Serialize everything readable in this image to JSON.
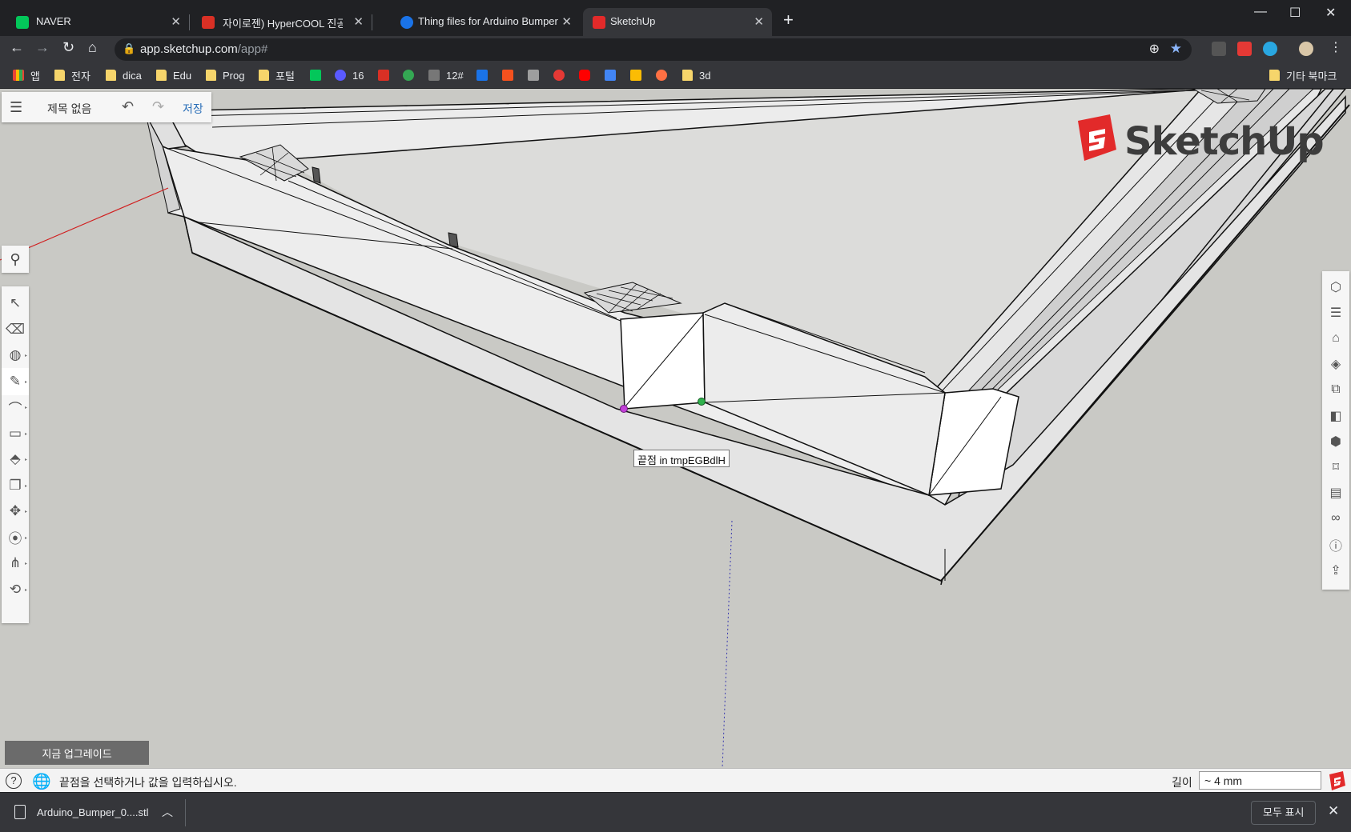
{
  "browser": {
    "tabs": [
      {
        "title": "NAVER",
        "favicon_color": "#03c75a",
        "favicon_letter": "N"
      },
      {
        "title": "자이로젠) HyperCOOL 진공 센서",
        "favicon_color": "#d93025",
        "favicon_letter": "M"
      },
      {
        "title": "Thing files for Arduino Bumper",
        "favicon_color": "#1a73e8",
        "favicon_letter": "T"
      },
      {
        "title": "SketchUp",
        "favicon_color": "#e22a2a",
        "favicon_letter": "S"
      }
    ],
    "new_tab_label": "+",
    "url_host": "app.sketchup.com",
    "url_path": "/app#",
    "bookmarks": [
      {
        "label": "앱",
        "type": "apps"
      },
      {
        "label": "전자",
        "type": "folder"
      },
      {
        "label": "dica",
        "type": "folder"
      },
      {
        "label": "Edu",
        "type": "folder"
      },
      {
        "label": "Prog",
        "type": "folder"
      },
      {
        "label": "포털",
        "type": "folder"
      },
      {
        "label": "",
        "type": "naver",
        "color": "#03c75a"
      },
      {
        "label": "16",
        "type": "site",
        "color": "#5a5aff"
      },
      {
        "label": "",
        "type": "gmail",
        "color": "#d93025"
      },
      {
        "label": "",
        "type": "site",
        "color": "#34a853"
      },
      {
        "label": "12#",
        "type": "site",
        "color": "#888888"
      },
      {
        "label": "",
        "type": "calendar",
        "color": "#1a73e8"
      },
      {
        "label": "",
        "type": "site",
        "color": "#f4511e"
      },
      {
        "label": "",
        "type": "site",
        "color": "#9e9e9e"
      },
      {
        "label": "",
        "type": "site",
        "color": "#e53935"
      },
      {
        "label": "",
        "type": "youtube",
        "color": "#ff0000"
      },
      {
        "label": "",
        "type": "translate",
        "color": "#4285f4"
      },
      {
        "label": "",
        "type": "maps",
        "color": "#fbbc04"
      },
      {
        "label": "",
        "type": "site",
        "color": "#ff7043"
      },
      {
        "label": "3d",
        "type": "folder"
      }
    ],
    "other_bookmarks": "기타 북마크"
  },
  "sketchup": {
    "doc_title": "제목 없음",
    "save_label": "저장",
    "logo_text": "SketchUp",
    "tooltip": "끝점 in tmpEGBdlH",
    "upgrade_label": "지금 업그레이드",
    "left_tools": [
      "select-icon",
      "eraser-icon",
      "paint-bucket-icon",
      "pencil-icon",
      "arc-icon",
      "rectangle-icon",
      "push-pull-icon",
      "offset-icon",
      "move-icon",
      "tape-measure-icon",
      "walk-icon",
      "orbit-icon"
    ],
    "right_tools": [
      "entity-info-icon",
      "outliner-icon",
      "instructor-icon",
      "materials-icon",
      "components-icon",
      "styles-icon",
      "views-icon",
      "tags-icon",
      "scenes-icon",
      "display-icon",
      "model-info-icon",
      "export-icon"
    ],
    "status_message": "끝점을 선택하거나 값을 입력하십시오.",
    "vcb_label": "길이",
    "vcb_value": "~ 4 mm"
  },
  "downloads": {
    "file_name": "Arduino_Bumper_0....stl",
    "show_all": "모두 표시"
  }
}
